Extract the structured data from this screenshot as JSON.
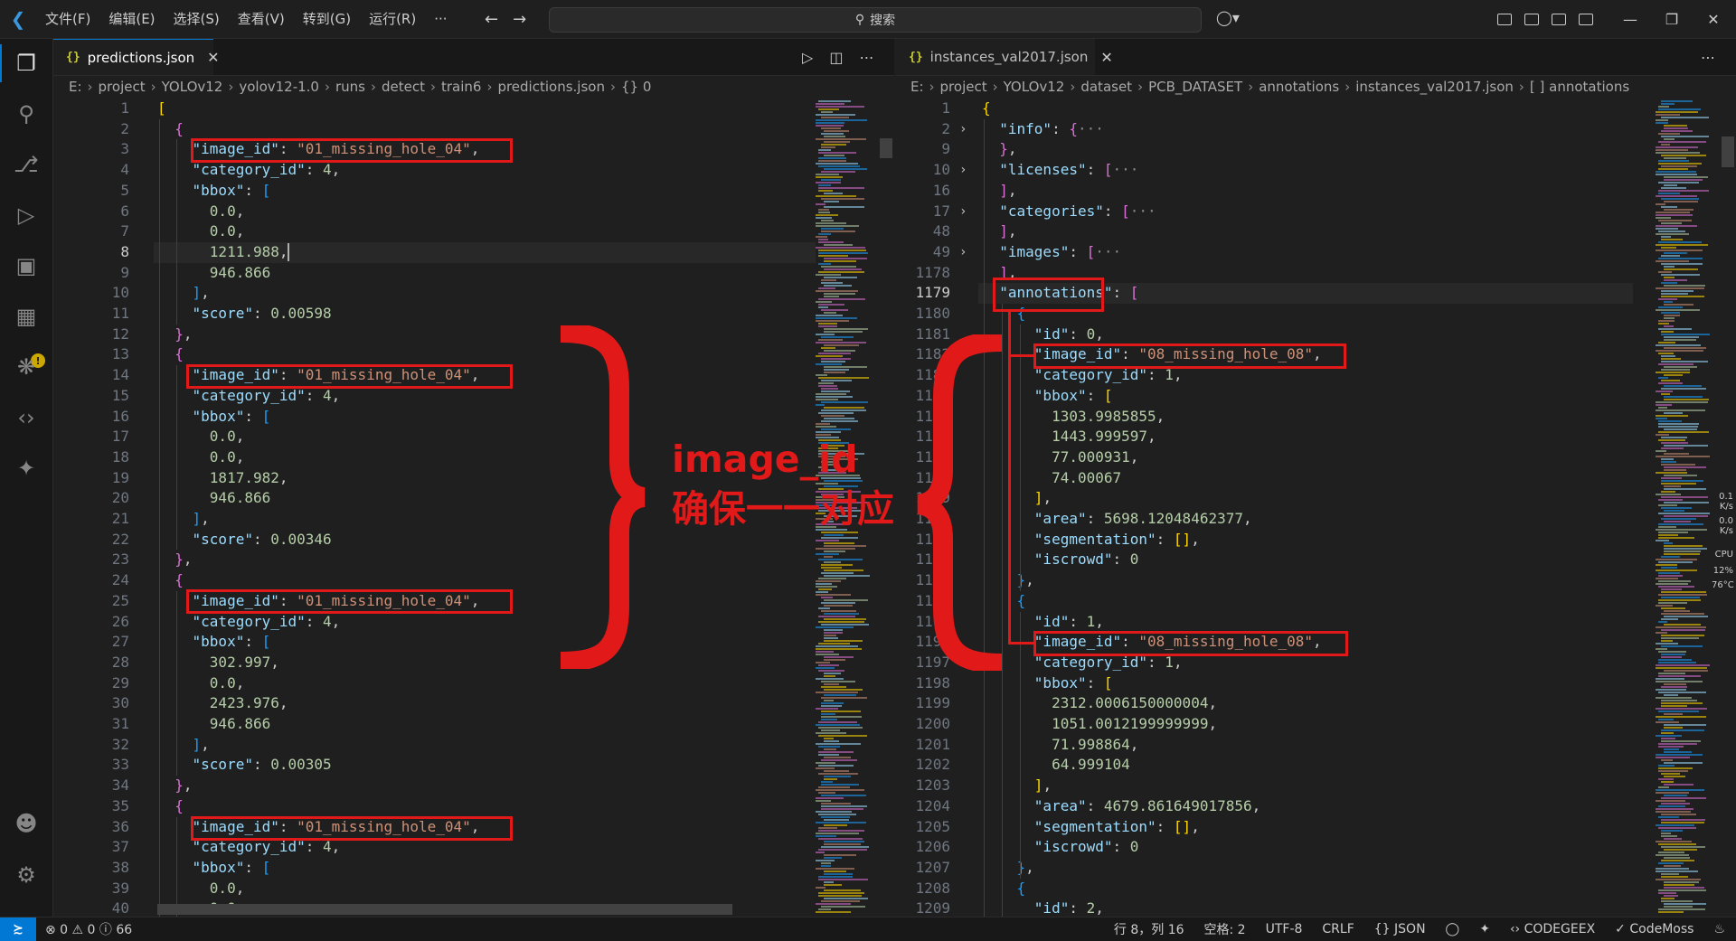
{
  "titlebar": {
    "menus": [
      "文件(F)",
      "编辑(E)",
      "选择(S)",
      "查看(V)",
      "转到(G)",
      "运行(R)",
      "···"
    ],
    "search_placeholder": "搜索"
  },
  "left_editor": {
    "tab": "predictions.json",
    "breadcrumb": [
      "E:",
      "project",
      "YOLOv12",
      "yolov12-1.0",
      "runs",
      "detect",
      "train6",
      "predictions.json",
      "{} 0"
    ],
    "lines": [
      {
        "n": "1",
        "t": [
          [
            "[",
            "b1"
          ]
        ]
      },
      {
        "n": "2",
        "t": [
          [
            "  {",
            "b2"
          ]
        ]
      },
      {
        "n": "3",
        "t": [
          [
            "    \"image_id\"",
            "k"
          ],
          [
            ": ",
            "p"
          ],
          [
            "\"01_missing_hole_04\"",
            "s"
          ],
          [
            ",",
            "p"
          ]
        ]
      },
      {
        "n": "4",
        "t": [
          [
            "    \"category_id\"",
            "k"
          ],
          [
            ": ",
            "p"
          ],
          [
            "4",
            "n"
          ],
          [
            ",",
            "p"
          ]
        ]
      },
      {
        "n": "5",
        "t": [
          [
            "    \"bbox\"",
            "k"
          ],
          [
            ": ",
            "p"
          ],
          [
            "[",
            "b3"
          ]
        ]
      },
      {
        "n": "6",
        "t": [
          [
            "      0.0",
            "n"
          ],
          [
            ",",
            "p"
          ]
        ]
      },
      {
        "n": "7",
        "t": [
          [
            "      0.0",
            "n"
          ],
          [
            ",",
            "p"
          ]
        ]
      },
      {
        "n": "8",
        "t": [
          [
            "      1211.988",
            "n"
          ],
          [
            ",",
            "p"
          ]
        ]
      },
      {
        "n": "9",
        "t": [
          [
            "      946.866",
            "n"
          ]
        ]
      },
      {
        "n": "10",
        "t": [
          [
            "    ]",
            "b3"
          ],
          [
            ",",
            "p"
          ]
        ]
      },
      {
        "n": "11",
        "t": [
          [
            "    \"score\"",
            "k"
          ],
          [
            ": ",
            "p"
          ],
          [
            "0.00598",
            "n"
          ]
        ]
      },
      {
        "n": "12",
        "t": [
          [
            "  }",
            "b2"
          ],
          [
            ",",
            "p"
          ]
        ]
      },
      {
        "n": "13",
        "t": [
          [
            "  {",
            "b2"
          ]
        ]
      },
      {
        "n": "14",
        "t": [
          [
            "    \"image_id\"",
            "k"
          ],
          [
            ": ",
            "p"
          ],
          [
            "\"01_missing_hole_04\"",
            "s"
          ],
          [
            ",",
            "p"
          ]
        ]
      },
      {
        "n": "15",
        "t": [
          [
            "    \"category_id\"",
            "k"
          ],
          [
            ": ",
            "p"
          ],
          [
            "4",
            "n"
          ],
          [
            ",",
            "p"
          ]
        ]
      },
      {
        "n": "16",
        "t": [
          [
            "    \"bbox\"",
            "k"
          ],
          [
            ": ",
            "p"
          ],
          [
            "[",
            "b3"
          ]
        ]
      },
      {
        "n": "17",
        "t": [
          [
            "      0.0",
            "n"
          ],
          [
            ",",
            "p"
          ]
        ]
      },
      {
        "n": "18",
        "t": [
          [
            "      0.0",
            "n"
          ],
          [
            ",",
            "p"
          ]
        ]
      },
      {
        "n": "19",
        "t": [
          [
            "      1817.982",
            "n"
          ],
          [
            ",",
            "p"
          ]
        ]
      },
      {
        "n": "20",
        "t": [
          [
            "      946.866",
            "n"
          ]
        ]
      },
      {
        "n": "21",
        "t": [
          [
            "    ]",
            "b3"
          ],
          [
            ",",
            "p"
          ]
        ]
      },
      {
        "n": "22",
        "t": [
          [
            "    \"score\"",
            "k"
          ],
          [
            ": ",
            "p"
          ],
          [
            "0.00346",
            "n"
          ]
        ]
      },
      {
        "n": "23",
        "t": [
          [
            "  }",
            "b2"
          ],
          [
            ",",
            "p"
          ]
        ]
      },
      {
        "n": "24",
        "t": [
          [
            "  {",
            "b2"
          ]
        ]
      },
      {
        "n": "25",
        "t": [
          [
            "    \"image_id\"",
            "k"
          ],
          [
            ": ",
            "p"
          ],
          [
            "\"01_missing_hole_04\"",
            "s"
          ],
          [
            ",",
            "p"
          ]
        ]
      },
      {
        "n": "26",
        "t": [
          [
            "    \"category_id\"",
            "k"
          ],
          [
            ": ",
            "p"
          ],
          [
            "4",
            "n"
          ],
          [
            ",",
            "p"
          ]
        ]
      },
      {
        "n": "27",
        "t": [
          [
            "    \"bbox\"",
            "k"
          ],
          [
            ": ",
            "p"
          ],
          [
            "[",
            "b3"
          ]
        ]
      },
      {
        "n": "28",
        "t": [
          [
            "      302.997",
            "n"
          ],
          [
            ",",
            "p"
          ]
        ]
      },
      {
        "n": "29",
        "t": [
          [
            "      0.0",
            "n"
          ],
          [
            ",",
            "p"
          ]
        ]
      },
      {
        "n": "30",
        "t": [
          [
            "      2423.976",
            "n"
          ],
          [
            ",",
            "p"
          ]
        ]
      },
      {
        "n": "31",
        "t": [
          [
            "      946.866",
            "n"
          ]
        ]
      },
      {
        "n": "32",
        "t": [
          [
            "    ]",
            "b3"
          ],
          [
            ",",
            "p"
          ]
        ]
      },
      {
        "n": "33",
        "t": [
          [
            "    \"score\"",
            "k"
          ],
          [
            ": ",
            "p"
          ],
          [
            "0.00305",
            "n"
          ]
        ]
      },
      {
        "n": "34",
        "t": [
          [
            "  }",
            "b2"
          ],
          [
            ",",
            "p"
          ]
        ]
      },
      {
        "n": "35",
        "t": [
          [
            "  {",
            "b2"
          ]
        ]
      },
      {
        "n": "36",
        "t": [
          [
            "    \"image_id\"",
            "k"
          ],
          [
            ": ",
            "p"
          ],
          [
            "\"01_missing_hole_04\"",
            "s"
          ],
          [
            ",",
            "p"
          ]
        ]
      },
      {
        "n": "37",
        "t": [
          [
            "    \"category_id\"",
            "k"
          ],
          [
            ": ",
            "p"
          ],
          [
            "4",
            "n"
          ],
          [
            ",",
            "p"
          ]
        ]
      },
      {
        "n": "38",
        "t": [
          [
            "    \"bbox\"",
            "k"
          ],
          [
            ": ",
            "p"
          ],
          [
            "[",
            "b3"
          ]
        ]
      },
      {
        "n": "39",
        "t": [
          [
            "      0.0",
            "n"
          ],
          [
            ",",
            "p"
          ]
        ]
      },
      {
        "n": "40",
        "t": [
          [
            "      0.0",
            "n"
          ],
          [
            ",",
            "p"
          ]
        ]
      }
    ]
  },
  "right_editor": {
    "tab": "instances_val2017.json",
    "breadcrumb": [
      "E:",
      "project",
      "YOLOv12",
      "dataset",
      "PCB_DATASET",
      "annotations",
      "instances_val2017.json",
      "[ ] annotations"
    ],
    "lines": [
      {
        "n": "1",
        "t": [
          [
            "{",
            "b1"
          ]
        ]
      },
      {
        "n": "2",
        "t": [
          [
            "  \"info\"",
            "k"
          ],
          [
            ": ",
            "p"
          ],
          [
            "{",
            "b2"
          ],
          [
            "···",
            "ellipsis"
          ]
        ]
      },
      {
        "n": "9",
        "t": [
          [
            "  }",
            "b2"
          ],
          [
            ",",
            "p"
          ]
        ]
      },
      {
        "n": "10",
        "t": [
          [
            "  \"licenses\"",
            "k"
          ],
          [
            ": ",
            "p"
          ],
          [
            "[",
            "b2"
          ],
          [
            "···",
            "ellipsis"
          ]
        ]
      },
      {
        "n": "16",
        "t": [
          [
            "  ]",
            "b2"
          ],
          [
            ",",
            "p"
          ]
        ]
      },
      {
        "n": "17",
        "t": [
          [
            "  \"categories\"",
            "k"
          ],
          [
            ": ",
            "p"
          ],
          [
            "[",
            "b2"
          ],
          [
            "···",
            "ellipsis"
          ]
        ]
      },
      {
        "n": "48",
        "t": [
          [
            "  ]",
            "b2"
          ],
          [
            ",",
            "p"
          ]
        ]
      },
      {
        "n": "49",
        "t": [
          [
            "  \"images\"",
            "k"
          ],
          [
            ": ",
            "p"
          ],
          [
            "[",
            "b2"
          ],
          [
            "···",
            "ellipsis"
          ]
        ]
      },
      {
        "n": "1178",
        "t": [
          [
            "  ]",
            "b2"
          ],
          [
            ",",
            "p"
          ]
        ]
      },
      {
        "n": "1179",
        "t": [
          [
            "  \"annotations\"",
            "k"
          ],
          [
            ": ",
            "p"
          ],
          [
            "[",
            "b2"
          ]
        ]
      },
      {
        "n": "1180",
        "t": [
          [
            "    {",
            "b3"
          ]
        ]
      },
      {
        "n": "1181",
        "t": [
          [
            "      \"id\"",
            "k"
          ],
          [
            ": ",
            "p"
          ],
          [
            "0",
            "n"
          ],
          [
            ",",
            "p"
          ]
        ]
      },
      {
        "n": "1182",
        "t": [
          [
            "      \"image_id\"",
            "k"
          ],
          [
            ": ",
            "p"
          ],
          [
            "\"08_missing_hole_08\"",
            "s"
          ],
          [
            ",",
            "p"
          ]
        ]
      },
      {
        "n": "1183",
        "t": [
          [
            "      \"category_id\"",
            "k"
          ],
          [
            ": ",
            "p"
          ],
          [
            "1",
            "n"
          ],
          [
            ",",
            "p"
          ]
        ]
      },
      {
        "n": "1184",
        "t": [
          [
            "      \"bbox\"",
            "k"
          ],
          [
            ": ",
            "p"
          ],
          [
            "[",
            "b1"
          ]
        ]
      },
      {
        "n": "1185",
        "t": [
          [
            "        1303.9985855",
            "n"
          ],
          [
            ",",
            "p"
          ]
        ]
      },
      {
        "n": "1186",
        "t": [
          [
            "        1443.999597",
            "n"
          ],
          [
            ",",
            "p"
          ]
        ]
      },
      {
        "n": "1187",
        "t": [
          [
            "        77.000931",
            "n"
          ],
          [
            ",",
            "p"
          ]
        ]
      },
      {
        "n": "1188",
        "t": [
          [
            "        74.00067",
            "n"
          ]
        ]
      },
      {
        "n": "1189",
        "t": [
          [
            "      ]",
            "b1"
          ],
          [
            ",",
            "p"
          ]
        ]
      },
      {
        "n": "1190",
        "t": [
          [
            "      \"area\"",
            "k"
          ],
          [
            ": ",
            "p"
          ],
          [
            "5698.12048462377",
            "n"
          ],
          [
            ",",
            "p"
          ]
        ]
      },
      {
        "n": "1191",
        "t": [
          [
            "      \"segmentation\"",
            "k"
          ],
          [
            ": ",
            "p"
          ],
          [
            "[]",
            "b1"
          ],
          [
            ",",
            "p"
          ]
        ]
      },
      {
        "n": "1192",
        "t": [
          [
            "      \"iscrowd\"",
            "k"
          ],
          [
            ": ",
            "p"
          ],
          [
            "0",
            "n"
          ]
        ]
      },
      {
        "n": "1193",
        "t": [
          [
            "    }",
            "b3"
          ],
          [
            ",",
            "p"
          ]
        ]
      },
      {
        "n": "1194",
        "t": [
          [
            "    {",
            "b3"
          ]
        ]
      },
      {
        "n": "1195",
        "t": [
          [
            "      \"id\"",
            "k"
          ],
          [
            ": ",
            "p"
          ],
          [
            "1",
            "n"
          ],
          [
            ",",
            "p"
          ]
        ]
      },
      {
        "n": "1196",
        "t": [
          [
            "      \"image_id\"",
            "k"
          ],
          [
            ": ",
            "p"
          ],
          [
            "\"08_missing_hole_08\"",
            "s"
          ],
          [
            ",",
            "p"
          ]
        ]
      },
      {
        "n": "1197",
        "t": [
          [
            "      \"category_id\"",
            "k"
          ],
          [
            ": ",
            "p"
          ],
          [
            "1",
            "n"
          ],
          [
            ",",
            "p"
          ]
        ]
      },
      {
        "n": "1198",
        "t": [
          [
            "      \"bbox\"",
            "k"
          ],
          [
            ": ",
            "p"
          ],
          [
            "[",
            "b1"
          ]
        ]
      },
      {
        "n": "1199",
        "t": [
          [
            "        2312.0006150000004",
            "n"
          ],
          [
            ",",
            "p"
          ]
        ]
      },
      {
        "n": "1200",
        "t": [
          [
            "        1051.0012199999999",
            "n"
          ],
          [
            ",",
            "p"
          ]
        ]
      },
      {
        "n": "1201",
        "t": [
          [
            "        71.998864",
            "n"
          ],
          [
            ",",
            "p"
          ]
        ]
      },
      {
        "n": "1202",
        "t": [
          [
            "        64.999104",
            "n"
          ]
        ]
      },
      {
        "n": "1203",
        "t": [
          [
            "      ]",
            "b1"
          ],
          [
            ",",
            "p"
          ]
        ]
      },
      {
        "n": "1204",
        "t": [
          [
            "      \"area\"",
            "k"
          ],
          [
            ": ",
            "p"
          ],
          [
            "4679.861649017856",
            "n"
          ],
          [
            ",",
            "p"
          ]
        ]
      },
      {
        "n": "1205",
        "t": [
          [
            "      \"segmentation\"",
            "k"
          ],
          [
            ": ",
            "p"
          ],
          [
            "[]",
            "b1"
          ],
          [
            ",",
            "p"
          ]
        ]
      },
      {
        "n": "1206",
        "t": [
          [
            "      \"iscrowd\"",
            "k"
          ],
          [
            ": ",
            "p"
          ],
          [
            "0",
            "n"
          ]
        ]
      },
      {
        "n": "1207",
        "t": [
          [
            "    }",
            "b3"
          ],
          [
            ",",
            "p"
          ]
        ]
      },
      {
        "n": "1208",
        "t": [
          [
            "    {",
            "b3"
          ]
        ]
      },
      {
        "n": "1209",
        "t": [
          [
            "      \"id\"",
            "k"
          ],
          [
            ": ",
            "p"
          ],
          [
            "2",
            "n"
          ],
          [
            ",",
            "p"
          ]
        ]
      }
    ]
  },
  "annotation": {
    "line1": "image_id",
    "line2": "确保一一对应"
  },
  "statusbar": {
    "problems": "⊗ 0 ⚠ 0 ⓘ 66",
    "position": "行 8，列 16",
    "spaces": "空格: 2",
    "encoding": "UTF-8",
    "eol": "CRLF",
    "language": "{} JSON",
    "codegeex": "CODEGEEX",
    "codemoss": "✓ CodeMoss"
  },
  "netmon": {
    "up": "0.1",
    "up_unit": "K/s",
    "down": "0.0",
    "down_unit": "K/s",
    "cpu_label": "CPU",
    "cpu": "12%",
    "temp": "76°C"
  },
  "colors": {
    "accent": "#0078d4",
    "annotation_red": "#e11919"
  }
}
